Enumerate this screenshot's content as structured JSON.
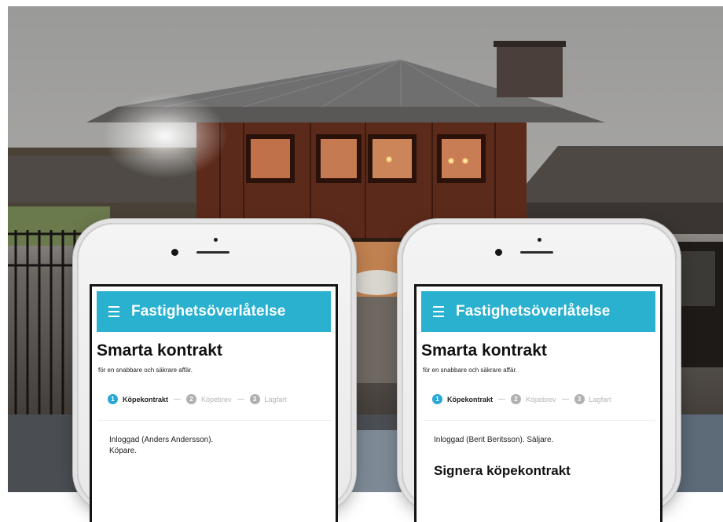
{
  "app": {
    "title": "Fastighetsöverlåtelse",
    "menu_icon": "hamburger-icon"
  },
  "page": {
    "heading": "Smarta kontrakt",
    "subtitle": "för en snabbare och säkrare affär."
  },
  "steps": [
    {
      "number": "1",
      "label": "Köpekontrakt",
      "state": "active"
    },
    {
      "number": "2",
      "label": "Köpebrev",
      "state": "inactive"
    },
    {
      "number": "3",
      "label": "Lagfart",
      "state": "inactive"
    }
  ],
  "phones": {
    "left": {
      "status_line1": "Inloggad (Anders Andersson).",
      "status_line2": "Köpare."
    },
    "right": {
      "status_line1": "Inloggad (Berit Beritsson). Säljare.",
      "section_title": "Signera köpekontrakt"
    }
  },
  "colors": {
    "accent": "#29b1cf",
    "step_active": "#2aa7d6",
    "step_inactive": "#b0b0b0"
  }
}
